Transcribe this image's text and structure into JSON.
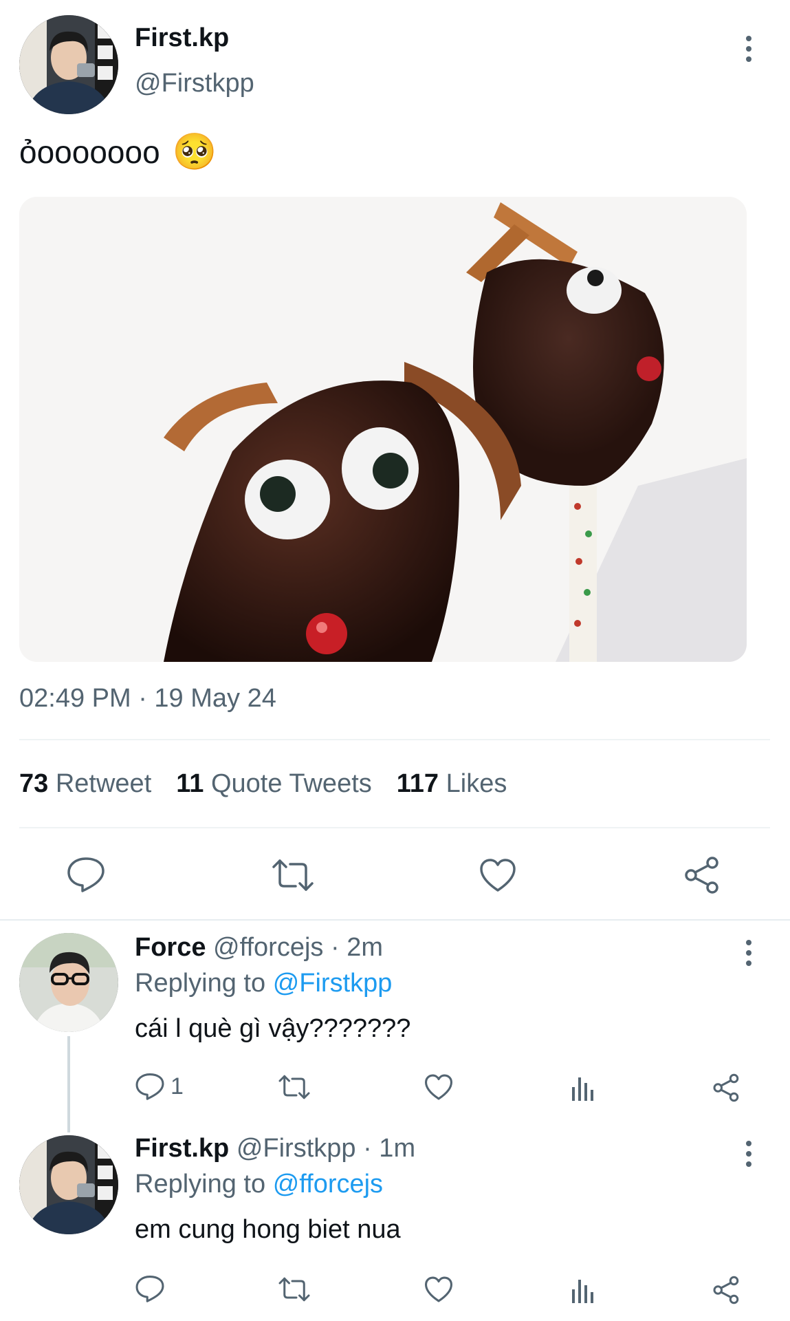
{
  "tweet": {
    "display_name": "First.kp",
    "handle": "@Firstkpp",
    "text": "ỏooooooo",
    "emoji": "🥺",
    "timestamp": "02:49 PM · 19 May 24",
    "stats": {
      "retweets_count": "73",
      "retweets_label": "Retweet",
      "quotes_count": "11",
      "quotes_label": "Quote Tweets",
      "likes_count": "117",
      "likes_label": "Likes"
    },
    "actions": [
      "reply-icon",
      "retweet-icon",
      "like-icon",
      "share-icon"
    ]
  },
  "replies": [
    {
      "display_name": "Force",
      "handle": "@fforcejs",
      "time": "· 2m",
      "replying_prefix": "Replying to",
      "replying_to": "@Firstkpp",
      "text": "cái l què gì vậy???????",
      "reply_count": "1"
    },
    {
      "display_name": "First.kp",
      "handle": "@Firstkpp",
      "time": "· 1m",
      "replying_prefix": "Replying to",
      "replying_to": "@fforcejs",
      "text": "em cung hong biet nua",
      "reply_count": ""
    }
  ],
  "colors": {
    "text": "#0f1419",
    "secondary": "#536471",
    "link": "#1d9bf0",
    "divider": "#eff3f4"
  }
}
